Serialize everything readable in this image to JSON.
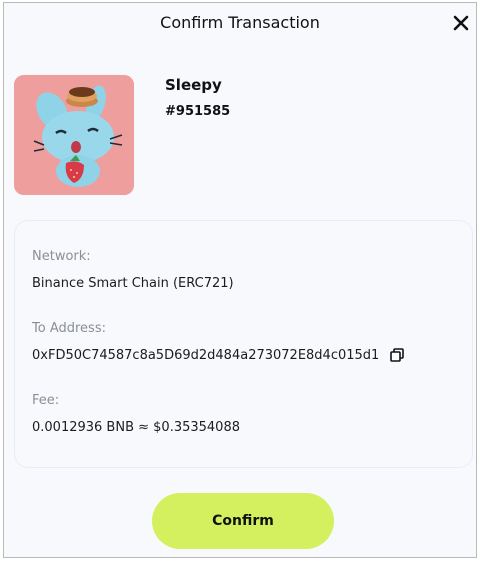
{
  "dialog": {
    "title": "Confirm Transaction",
    "close_icon": "close-icon"
  },
  "nft": {
    "name": "Sleepy",
    "token_id": "#951585",
    "image_icon": "sleepy-bunny-nft-image"
  },
  "details": {
    "network_label": "Network:",
    "network_value": "Binance Smart Chain (ERC721)",
    "to_address_label": "To Address:",
    "to_address_value": "0xFD50C74587c8a5D69d2d484a273072E8d4c015d1",
    "copy_icon": "copy-icon",
    "fee_label": "Fee:",
    "fee_value": "0.0012936 BNB ≈ $0.35354088"
  },
  "actions": {
    "confirm_label": "Confirm"
  },
  "colors": {
    "accent": "#d4f05f",
    "image_background": "#ee9e9d",
    "panel_background": "#f7f9fd"
  }
}
